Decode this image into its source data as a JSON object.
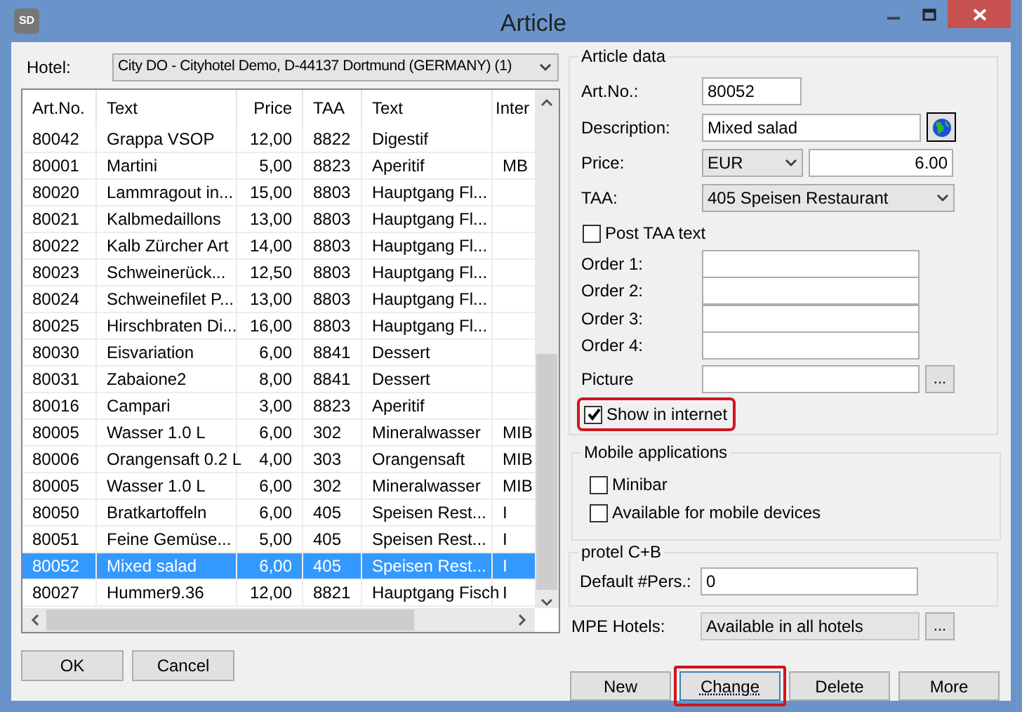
{
  "window": {
    "title": "Article",
    "app_icon_text": "SD"
  },
  "hotel": {
    "label": "Hotel:",
    "value": "City DO - Cityhotel Demo, D-44137 Dortmund (GERMANY)  (1)"
  },
  "table": {
    "columns": [
      "Art.No.",
      "Text",
      "Price",
      "TAA",
      "Text",
      "Inter"
    ],
    "rows": [
      {
        "cells": [
          "80042",
          "Grappa VSOP",
          "12,00",
          "8822",
          "Digestif",
          null
        ],
        "selected": false
      },
      {
        "cells": [
          "80001",
          "Martini",
          "5,00",
          "8823",
          "Aperitif",
          "MB"
        ],
        "selected": false
      },
      {
        "cells": [
          "80020",
          "Lammragout in...",
          "15,00",
          "8803",
          "Hauptgang Fl...",
          null
        ],
        "selected": false
      },
      {
        "cells": [
          "80021",
          "Kalbmedaillons",
          "13,00",
          "8803",
          "Hauptgang Fl...",
          null
        ],
        "selected": false
      },
      {
        "cells": [
          "80022",
          "Kalb Zürcher Art",
          "14,00",
          "8803",
          "Hauptgang Fl...",
          null
        ],
        "selected": false
      },
      {
        "cells": [
          "80023",
          "Schweinerück...",
          "12,50",
          "8803",
          "Hauptgang Fl...",
          null
        ],
        "selected": false
      },
      {
        "cells": [
          "80024",
          "Schweinefilet P...",
          "13,00",
          "8803",
          "Hauptgang Fl...",
          null
        ],
        "selected": false
      },
      {
        "cells": [
          "80025",
          "Hirschbraten Di...",
          "16,00",
          "8803",
          "Hauptgang Fl...",
          null
        ],
        "selected": false
      },
      {
        "cells": [
          "80030",
          "Eisvariation",
          "6,00",
          "8841",
          "Dessert",
          null
        ],
        "selected": false
      },
      {
        "cells": [
          "80031",
          "Zabaione2",
          "8,00",
          "8841",
          "Dessert",
          null
        ],
        "selected": false
      },
      {
        "cells": [
          "80016",
          "Campari",
          "3,00",
          "8823",
          "Aperitif",
          null
        ],
        "selected": false
      },
      {
        "cells": [
          "80005",
          "Wasser 1.0 L",
          "6,00",
          "302",
          "Mineralwasser",
          "MIB"
        ],
        "selected": false
      },
      {
        "cells": [
          "80006",
          "Orangensaft 0.2 L",
          "4,00",
          "303",
          "Orangensaft",
          "MIB"
        ],
        "selected": false
      },
      {
        "cells": [
          "80005",
          "Wasser 1.0 L",
          "6,00",
          "302",
          "Mineralwasser",
          "MIB"
        ],
        "selected": false
      },
      {
        "cells": [
          "80050",
          "Bratkartoffeln",
          "6,00",
          "405",
          "Speisen Rest...",
          "I"
        ],
        "selected": false
      },
      {
        "cells": [
          "80051",
          "Feine Gemüse...",
          "5,00",
          "405",
          "Speisen Rest...",
          "I"
        ],
        "selected": false
      },
      {
        "cells": [
          "80052",
          "Mixed salad",
          "6,00",
          "405",
          "Speisen Rest...",
          "I"
        ],
        "selected": true
      },
      {
        "cells": [
          "80027",
          "Hummer9.36",
          "12,00",
          "8821",
          "Hauptgang Fisch",
          "I"
        ],
        "selected": false
      }
    ]
  },
  "dialog_buttons": [
    "OK",
    "Cancel"
  ],
  "article_data": {
    "title": "Article data",
    "art_no": {
      "label": "Art.No.:",
      "value": "80052"
    },
    "description": {
      "label": "Description:",
      "value": "Mixed salad"
    },
    "price": {
      "label": "Price:",
      "currency": "EUR",
      "value": "6.00"
    },
    "taa": {
      "label": "TAA:",
      "value": "405 Speisen Restaurant"
    },
    "post_taa": {
      "label": "Post TAA text",
      "checked": false,
      "highlighted": false
    },
    "orders": [
      {
        "label": "Order 1:"
      },
      {
        "label": "Order 2:"
      },
      {
        "label": "Order 3:"
      },
      {
        "label": "Order 4:"
      }
    ],
    "picture": {
      "label": "Picture",
      "button": "..."
    },
    "show_in_internet": {
      "label": "Show in internet",
      "checked": true,
      "highlighted": true
    }
  },
  "mobile_applications": {
    "title": "Mobile applications",
    "options": [
      {
        "label": "Minibar",
        "checked": false
      },
      {
        "label": "Available for mobile devices",
        "checked": false
      }
    ]
  },
  "protel": {
    "title": "protel C+B",
    "default_pers": {
      "label": "Default #Pers.:",
      "value": "0"
    }
  },
  "mpe_hotels": {
    "label": "MPE Hotels:",
    "value": "Available in all hotels",
    "button": "..."
  },
  "actions": [
    {
      "label": "New",
      "focused": false,
      "highlighted": false
    },
    {
      "label": "Change",
      "focused": true,
      "highlighted": true
    },
    {
      "label": "Delete",
      "focused": false,
      "highlighted": false
    },
    {
      "label": "More",
      "focused": false,
      "highlighted": false
    }
  ]
}
